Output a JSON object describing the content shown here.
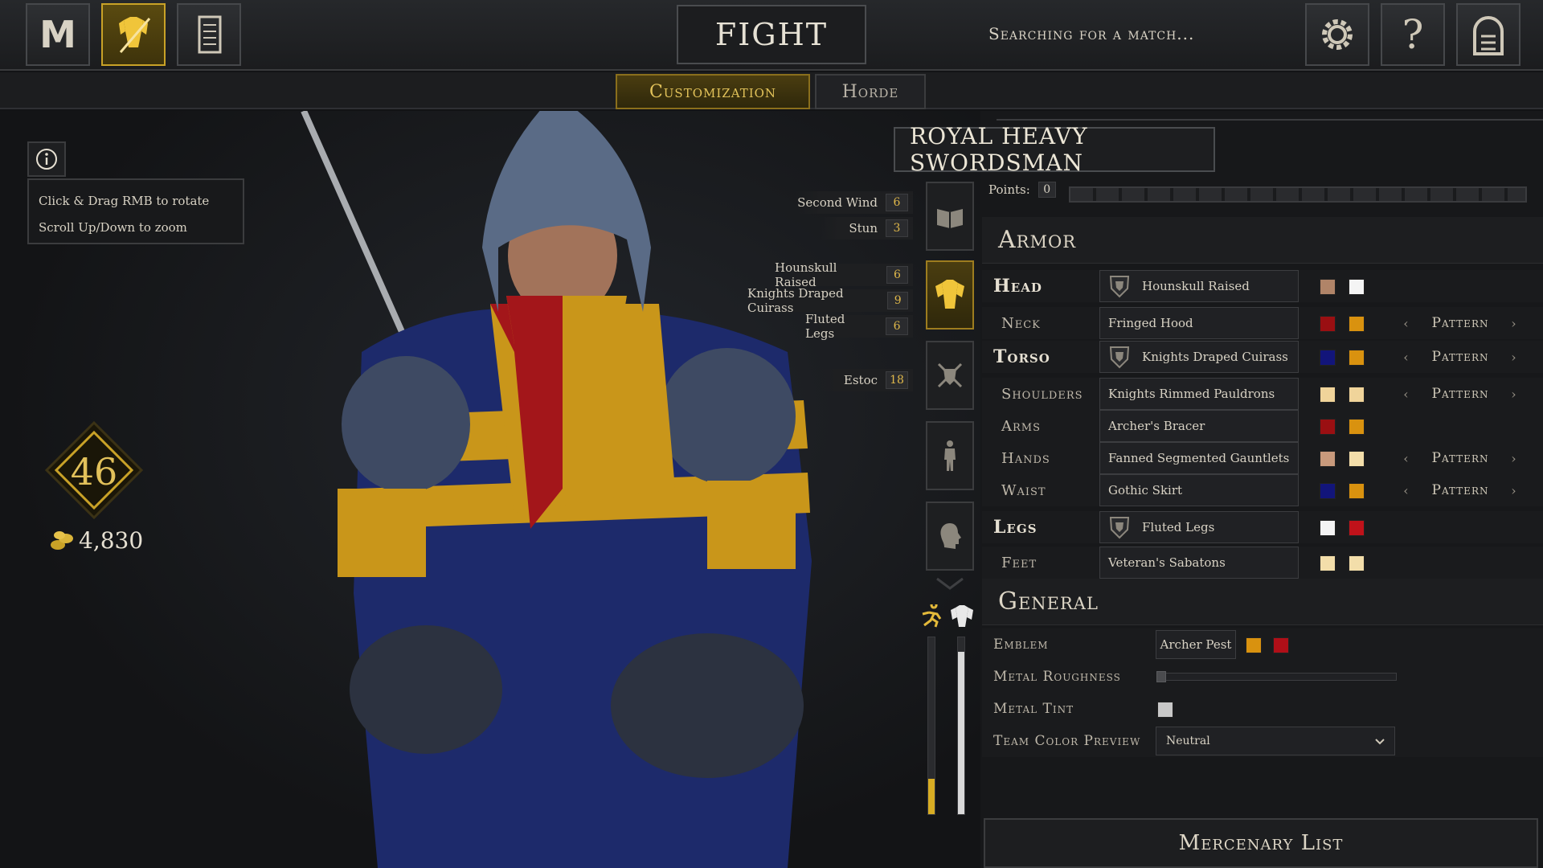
{
  "topbar": {
    "fight_label": "FIGHT",
    "search_status": "Searching for a match...",
    "menu_glyph": "M"
  },
  "tabs": [
    {
      "label": "Customization",
      "active": true
    },
    {
      "label": "Horde",
      "active": false
    }
  ],
  "viewport": {
    "hint_rotate": "Click & Drag RMB to rotate",
    "hint_zoom": "Scroll Up/Down to zoom",
    "level": "46",
    "currency": "4,830"
  },
  "perks": [
    {
      "name": "Second Wind",
      "cost": "6"
    },
    {
      "name": "Stun",
      "cost": "3"
    },
    {
      "name": "Hounskull Raised",
      "cost": "6"
    },
    {
      "name": "Knights Draped Cuirass",
      "cost": "9"
    },
    {
      "name": "Fluted Legs",
      "cost": "6"
    },
    {
      "name": "Estoc",
      "cost": "18"
    }
  ],
  "class_name": "ROYAL HEAVY SWORDSMAN",
  "points": {
    "label": "Points:",
    "value": "0"
  },
  "armor": {
    "title": "Armor",
    "pattern_label": "Pattern",
    "rows": [
      {
        "slot": "Head",
        "item": "Hounskull Raised",
        "colors": [
          "#b08468",
          "#f4f4f4"
        ]
      },
      {
        "slot": "Neck",
        "item": "Fringed Hood",
        "colors": [
          "#9a0f12",
          "#d9920f"
        ]
      },
      {
        "slot": "Torso",
        "item": "Knights Draped Cuirass",
        "colors": [
          "#12157a",
          "#d9920f"
        ]
      },
      {
        "slot": "Shoulders",
        "item": "Knights Rimmed Pauldrons",
        "colors": [
          "#f0d49a",
          "#f0d49a"
        ]
      },
      {
        "slot": "Arms",
        "item": "Archer's Bracer",
        "colors": [
          "#9a0f12",
          "#d9920f"
        ]
      },
      {
        "slot": "Hands",
        "item": "Fanned Segmented Gauntlets",
        "colors": [
          "#c89a7c",
          "#f3deaa"
        ]
      },
      {
        "slot": "Waist",
        "item": "Gothic Skirt",
        "colors": [
          "#12157a",
          "#d9920f"
        ]
      },
      {
        "slot": "Legs",
        "item": "Fluted Legs",
        "colors": [
          "#f4f4f4",
          "#c0121a"
        ]
      },
      {
        "slot": "Feet",
        "item": "Veteran's Sabatons",
        "colors": [
          "#f3deaa",
          "#f3deaa"
        ]
      }
    ]
  },
  "general": {
    "title": "General",
    "emblem_label": "Emblem",
    "emblem_value": "Archer Pest",
    "emblem_colors": [
      "#d9920f",
      "#b00f18"
    ],
    "metal_roughness_label": "Metal Roughness",
    "metal_roughness_value": 0.0,
    "metal_tint_label": "Metal Tint",
    "metal_tint_color": "#c8c8c8",
    "team_color_label": "Team Color Preview",
    "team_color_value": "Neutral"
  },
  "mercenary_list": "Mercenary List",
  "gauges": {
    "speed_fill": 0.2,
    "armor_fill": 0.92
  },
  "colors": {
    "gold": "#c9a227",
    "panel": "#17181a"
  }
}
